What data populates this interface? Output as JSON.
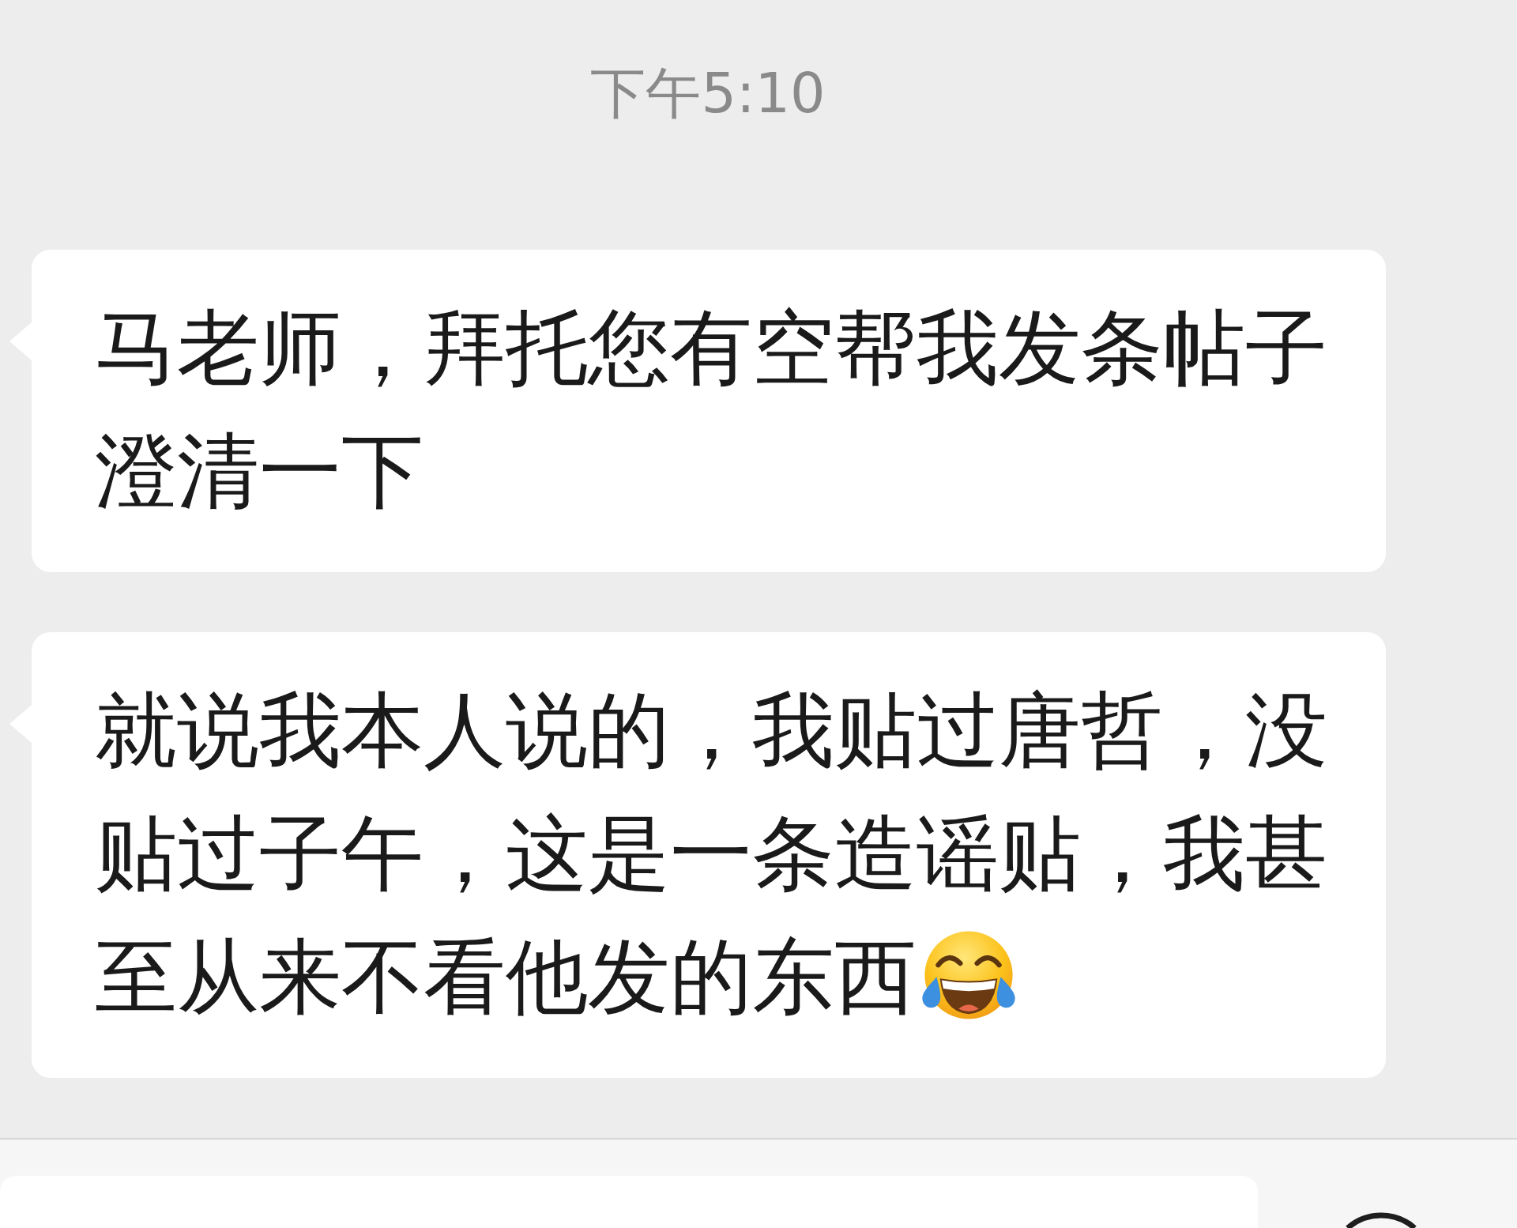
{
  "timestamp": "下午5:10",
  "messages": [
    {
      "text": "马老师，拜托您有空帮我发条帖子澄清一下",
      "trailing_emoji": false
    },
    {
      "text": "就说我本人说的，我贴过唐哲，没贴过子午，这是一条造谣贴，我甚至从来不看他发的东西",
      "trailing_emoji": true
    }
  ]
}
